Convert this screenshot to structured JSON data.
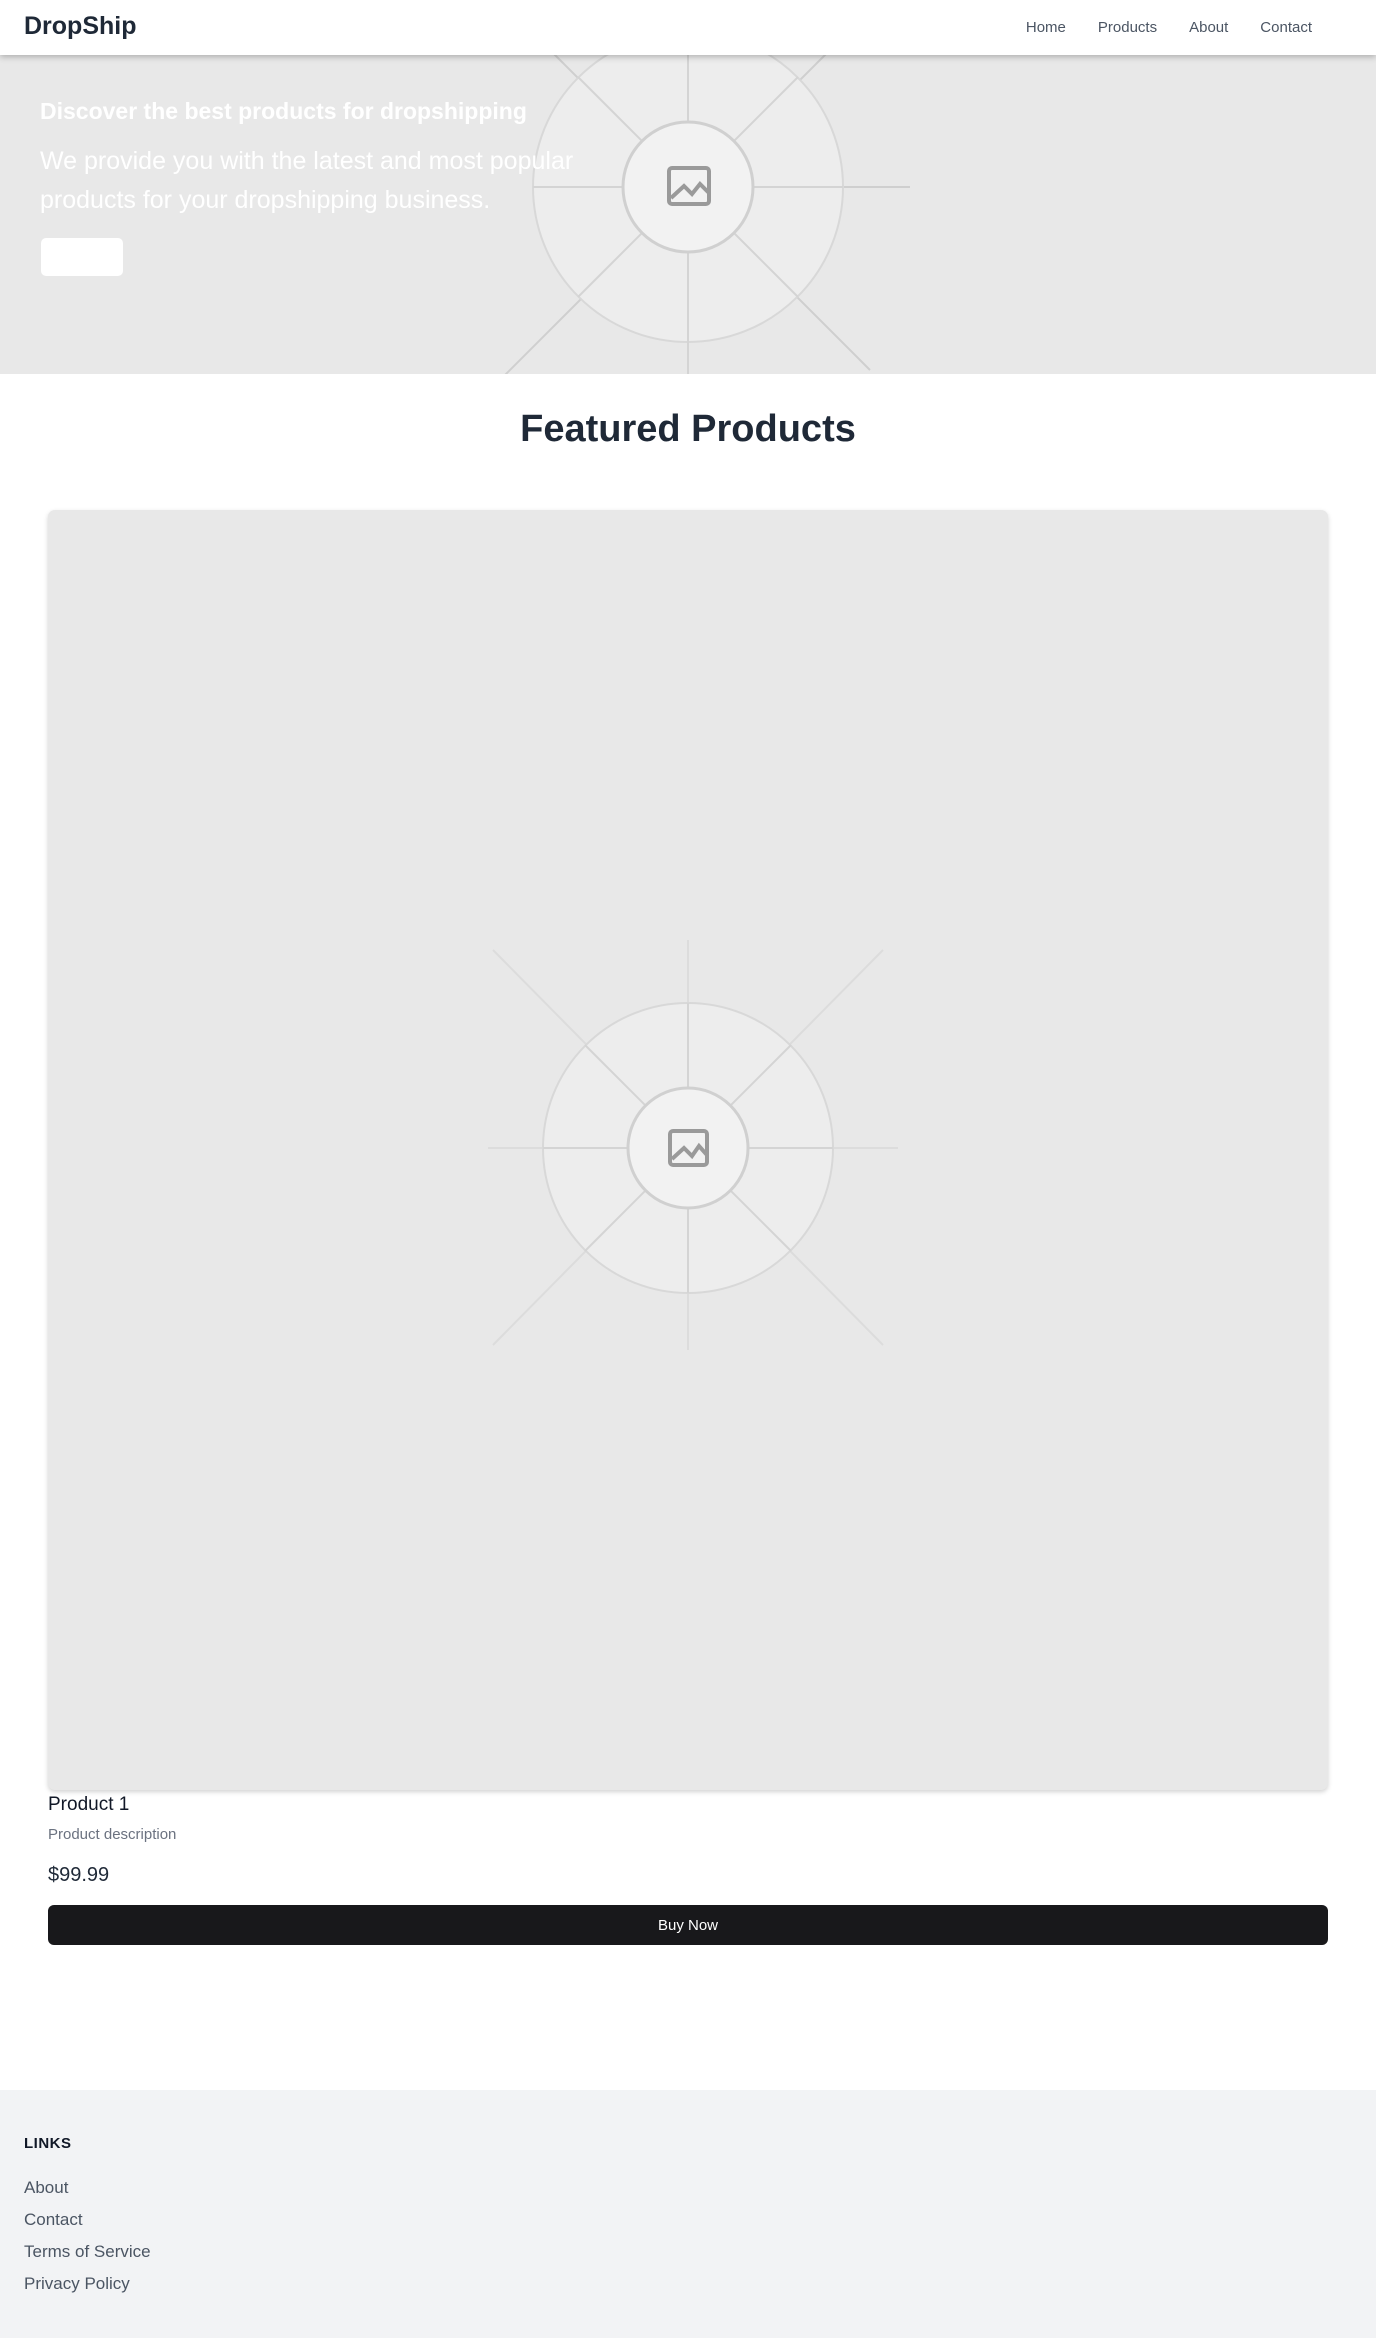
{
  "header": {
    "brand": "DropShip",
    "nav": [
      {
        "label": "Home"
      },
      {
        "label": "Products"
      },
      {
        "label": "About"
      },
      {
        "label": "Contact"
      }
    ]
  },
  "hero": {
    "title": "Discover the best products for dropshipping",
    "text": "We provide you with the latest and most popular products for your dropshipping business.",
    "button_label": "",
    "image_icon": "image-placeholder-icon"
  },
  "featured": {
    "title": "Featured Products",
    "products": [
      {
        "name": "Product 1",
        "description": "Product description",
        "price": "$99.99",
        "button_label": "Buy Now",
        "image_icon": "image-placeholder-icon"
      }
    ]
  },
  "footer": {
    "heading": "LINKS",
    "links": [
      {
        "label": "About"
      },
      {
        "label": "Contact"
      },
      {
        "label": "Terms of Service"
      },
      {
        "label": "Privacy Policy"
      }
    ]
  },
  "colors": {
    "placeholder_bg": "#e8e8e8",
    "button_dark": "#18181b",
    "footer_bg": "#f2f3f5"
  }
}
